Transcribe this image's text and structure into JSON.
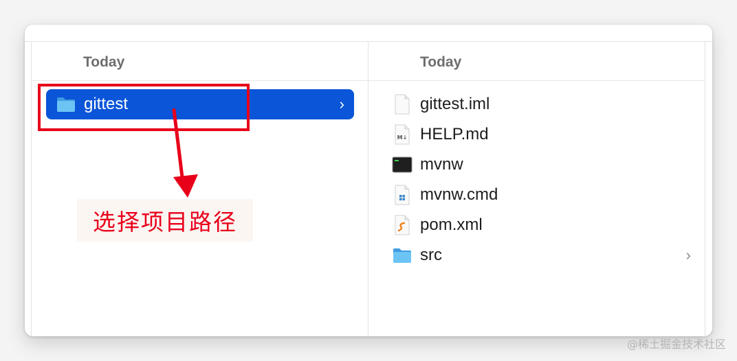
{
  "columns": {
    "left": {
      "header": "Today",
      "items": [
        {
          "name": "gittest",
          "icon": "folder-icon",
          "has_children": true,
          "selected": true,
          "chevron": "›"
        }
      ]
    },
    "right": {
      "header": "Today",
      "items": [
        {
          "name": "gittest.iml",
          "icon": "generic-file-icon"
        },
        {
          "name": "HELP.md",
          "icon": "markdown-file-icon"
        },
        {
          "name": "mvnw",
          "icon": "terminal-executable-icon"
        },
        {
          "name": "mvnw.cmd",
          "icon": "windows-cmd-file-icon"
        },
        {
          "name": "pom.xml",
          "icon": "xml-file-icon"
        },
        {
          "name": "src",
          "icon": "folder-icon",
          "has_children": true,
          "chevron": "›"
        }
      ]
    }
  },
  "annotation": {
    "text": "选择项目路径"
  },
  "watermark": "@稀土掘金技术社区",
  "colors": {
    "selection": "#0a55d8",
    "annotation": "#e8001a",
    "folder": "#5cb8f0",
    "header_text": "#6e6e6e"
  }
}
